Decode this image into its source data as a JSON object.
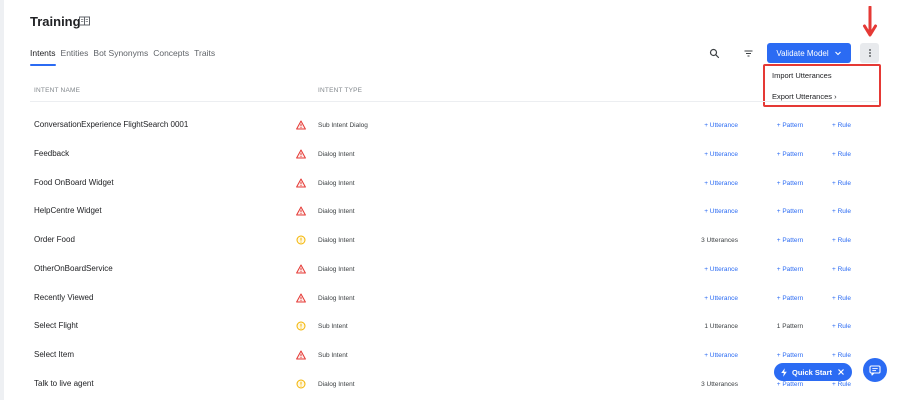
{
  "page": {
    "title": "Training"
  },
  "tabs": [
    {
      "label": "Intents",
      "active": true
    },
    {
      "label": "Entities",
      "active": false
    },
    {
      "label": "Bot Synonyms",
      "active": false
    },
    {
      "label": "Concepts",
      "active": false
    },
    {
      "label": "Traits",
      "active": false
    }
  ],
  "toolbar": {
    "validate_label": "Validate Model",
    "search_icon": "search-icon",
    "filter_icon": "filter-icon",
    "more_icon": "more-vertical-icon"
  },
  "menu": {
    "items": [
      "Import Utterances",
      "Export Utterances ›"
    ]
  },
  "table": {
    "columns": [
      "INTENT NAME",
      "INTENT TYPE"
    ],
    "rows": [
      {
        "name": "ConversationExperience FlightSearch 0001",
        "status": "warning-red",
        "type": "Sub Intent Dialog",
        "utterance": "+ Utterance",
        "pattern": "+ Pattern",
        "rule": "+ Rule"
      },
      {
        "name": "Feedback",
        "status": "warning-red",
        "type": "Dialog Intent",
        "utterance": "+ Utterance",
        "pattern": "+ Pattern",
        "rule": "+ Rule"
      },
      {
        "name": "Food OnBoard Widget",
        "status": "warning-red",
        "type": "Dialog Intent",
        "utterance": "+ Utterance",
        "pattern": "+ Pattern",
        "rule": "+ Rule"
      },
      {
        "name": "HelpCentre Widget",
        "status": "warning-red",
        "type": "Dialog Intent",
        "utterance": "+ Utterance",
        "pattern": "+ Pattern",
        "rule": "+ Rule"
      },
      {
        "name": "Order Food",
        "status": "info-yellow",
        "type": "Dialog Intent",
        "utterance": "3 Utterances",
        "pattern": "+ Pattern",
        "rule": "+ Rule"
      },
      {
        "name": "OtherOnBoardService",
        "status": "warning-red",
        "type": "Dialog Intent",
        "utterance": "+ Utterance",
        "pattern": "+ Pattern",
        "rule": "+ Rule"
      },
      {
        "name": "Recently Viewed",
        "status": "warning-red",
        "type": "Dialog Intent",
        "utterance": "+ Utterance",
        "pattern": "+ Pattern",
        "rule": "+ Rule"
      },
      {
        "name": "Select Flight",
        "status": "info-yellow",
        "type": "Sub Intent",
        "utterance": "1 Utterance",
        "pattern": "1 Pattern",
        "rule": "+ Rule"
      },
      {
        "name": "Select Item",
        "status": "warning-red",
        "type": "Sub Intent",
        "utterance": "+ Utterance",
        "pattern": "+ Pattern",
        "rule": "+ Rule"
      },
      {
        "name": "Talk to live agent",
        "status": "info-yellow",
        "type": "Dialog Intent",
        "utterance": "3 Utterances",
        "pattern": "+ Pattern",
        "rule": "+ Rule"
      }
    ]
  },
  "quick_start": {
    "label": "Quick Start"
  },
  "colors": {
    "accent": "#2b6bf3",
    "warning_red": "#e53935",
    "info_yellow": "#f4b400",
    "annotation_red": "#e53935"
  }
}
